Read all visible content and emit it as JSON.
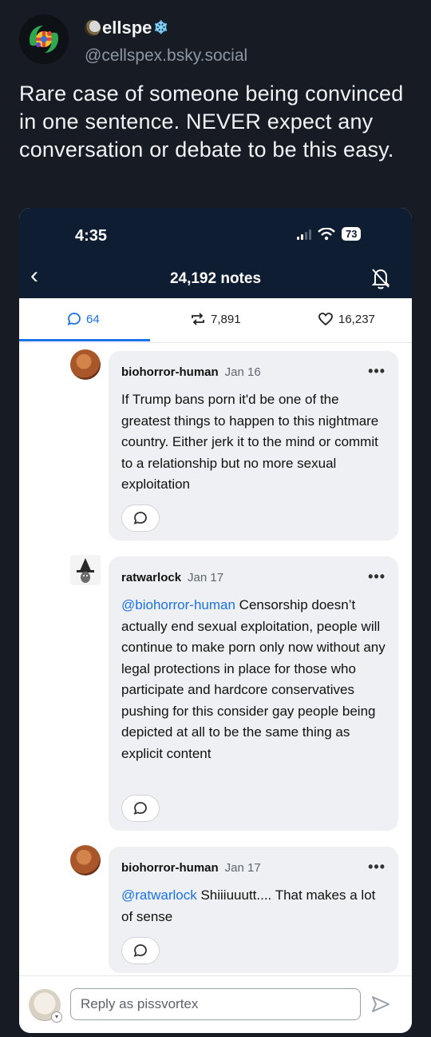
{
  "post": {
    "display_name": "ellspe",
    "name_prefix_icon": "moon-icon",
    "name_suffix_icon": "snowflake-icon",
    "snowflake_glyph": "❄",
    "handle": "@cellspex.bsky.social",
    "text": "Rare case of someone being convinced in one sentence. NEVER expect any conversation or debate to be this easy."
  },
  "screenshot": {
    "status_bar": {
      "time": "4:35",
      "battery": "73"
    },
    "header": {
      "back_glyph": "‹",
      "title": "24,192 notes"
    },
    "tabs": [
      {
        "label": "64",
        "icon": "comment-icon"
      },
      {
        "label": "7,891",
        "icon": "reblog-icon"
      },
      {
        "label": "16,237",
        "icon": "heart-icon"
      }
    ],
    "replies": [
      {
        "user": "biohorror-human",
        "date": "Jan 16",
        "mention": "",
        "text": "If Trump bans porn it'd be one of the greatest things to happen to this nightmare country. Either jerk it to the mind or commit to a relationship but no more sexual exploitation"
      },
      {
        "user": "ratwarlock",
        "date": "Jan 17",
        "mention": "@biohorror-human",
        "text": " Censorship doesn’t actually end sexual exploitation, people will continue to make porn only now without any legal protections in place for those who participate and hardcore conservatives pushing for this consider gay people being depicted at all to be the same thing as explicit content"
      },
      {
        "user": "biohorror-human",
        "date": "Jan 17",
        "mention": "@ratwarlock",
        "text": " Shiiiuuutt.... That makes a lot of sense"
      }
    ],
    "more_glyph": "•••",
    "reply_placeholder": "Reply as pissvortex",
    "colors": {
      "nav_bg": "#0f1d33",
      "accent": "#1a73e8",
      "bubble_bg": "#eef0f3"
    }
  }
}
